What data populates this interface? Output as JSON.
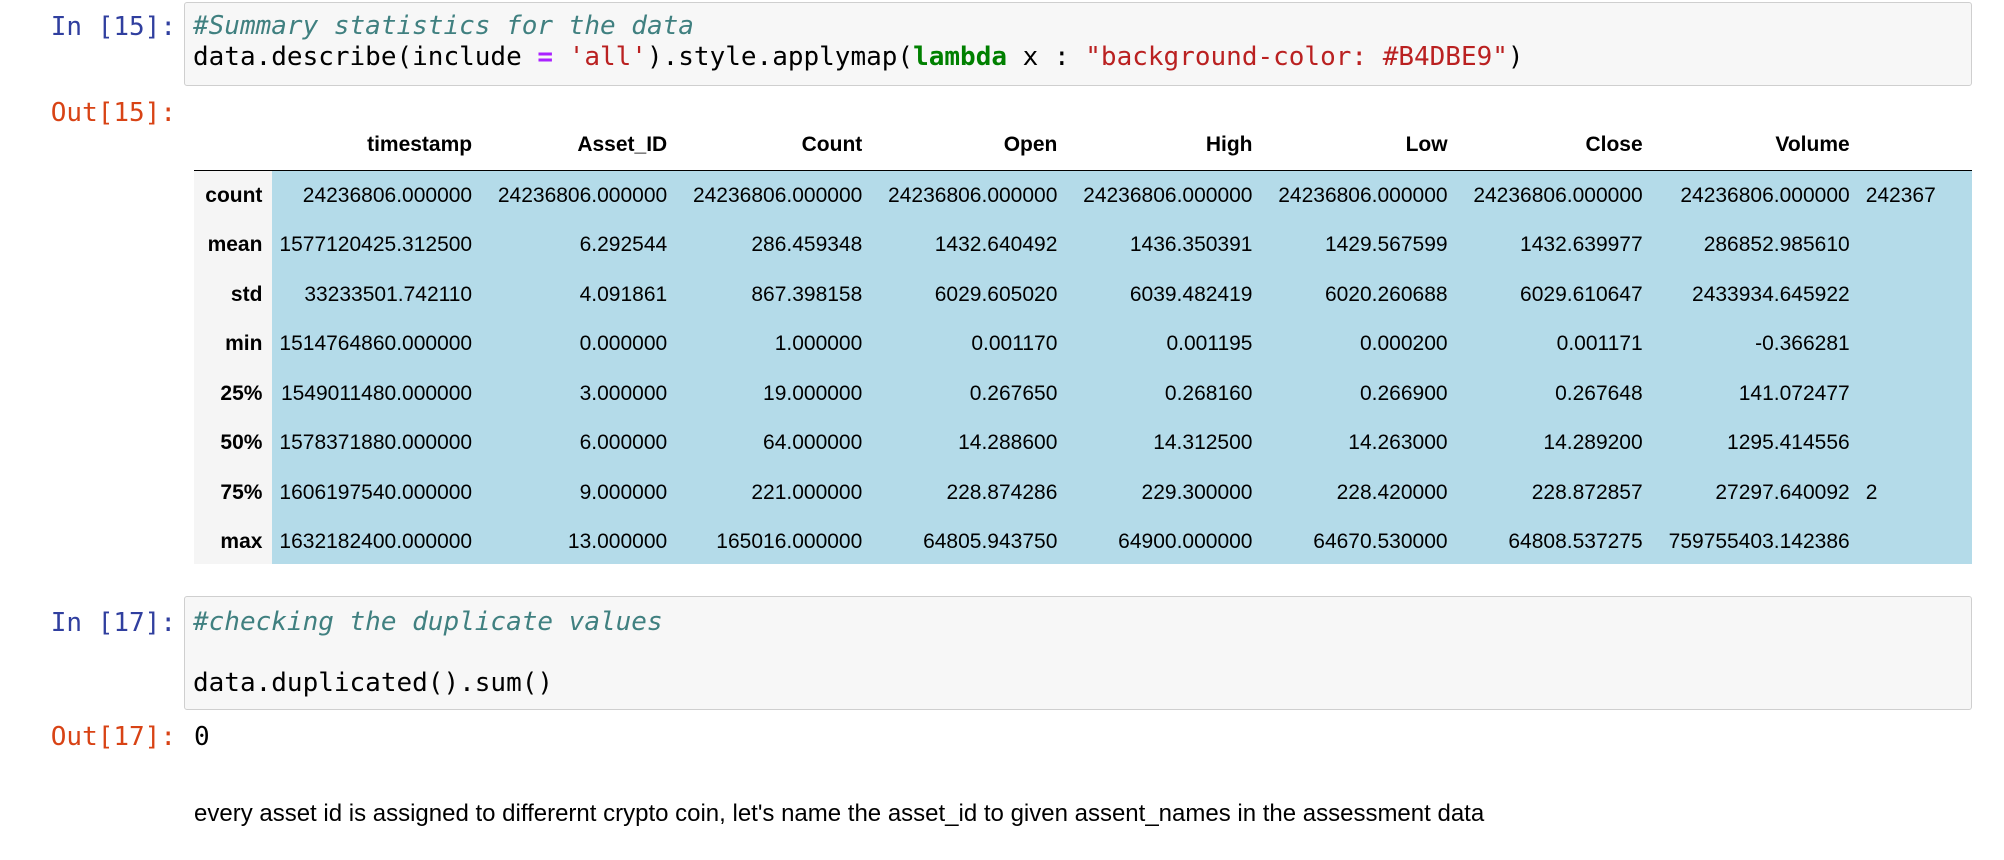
{
  "cells": {
    "in15": {
      "prompt": "In [15]:",
      "comment": "#Summary statistics for the data",
      "code_a": "data.describe(include ",
      "code_eq": "=",
      "code_b": " ",
      "code_str1": "'all'",
      "code_c": ").style.applymap(",
      "code_kw": "lambda",
      "code_d": " x : ",
      "code_str2": "\"background-color: #B4DBE9\"",
      "code_e": ")"
    },
    "out15": {
      "prompt": "Out[15]:"
    },
    "in17": {
      "prompt": "In [17]:",
      "comment": "#checking the duplicate values",
      "code": "data.duplicated().sum()"
    },
    "out17": {
      "prompt": "Out[17]:",
      "value": "0"
    },
    "markdown": {
      "text": "every asset id is assigned to differernt crypto coin, let's name the asset_id to given assent_names in the assessment data"
    }
  },
  "table": {
    "highlight_color": "#B4DBE9",
    "columns": [
      "timestamp",
      "Asset_ID",
      "Count",
      "Open",
      "High",
      "Low",
      "Close",
      "Volume",
      ""
    ],
    "rows": [
      {
        "index": "count",
        "values": [
          "24236806.000000",
          "24236806.000000",
          "24236806.000000",
          "24236806.000000",
          "24236806.000000",
          "24236806.000000",
          "24236806.000000",
          "24236806.000000",
          "242367"
        ]
      },
      {
        "index": "mean",
        "values": [
          "1577120425.312500",
          "6.292544",
          "286.459348",
          "1432.640492",
          "1436.350391",
          "1429.567599",
          "1432.639977",
          "286852.985610",
          ""
        ]
      },
      {
        "index": "std",
        "values": [
          "33233501.742110",
          "4.091861",
          "867.398158",
          "6029.605020",
          "6039.482419",
          "6020.260688",
          "6029.610647",
          "2433934.645922",
          ""
        ]
      },
      {
        "index": "min",
        "values": [
          "1514764860.000000",
          "0.000000",
          "1.000000",
          "0.001170",
          "0.001195",
          "0.000200",
          "0.001171",
          "-0.366281",
          ""
        ]
      },
      {
        "index": "25%",
        "values": [
          "1549011480.000000",
          "3.000000",
          "19.000000",
          "0.267650",
          "0.268160",
          "0.266900",
          "0.267648",
          "141.072477",
          ""
        ]
      },
      {
        "index": "50%",
        "values": [
          "1578371880.000000",
          "6.000000",
          "64.000000",
          "14.288600",
          "14.312500",
          "14.263000",
          "14.289200",
          "1295.414556",
          ""
        ]
      },
      {
        "index": "75%",
        "values": [
          "1606197540.000000",
          "9.000000",
          "221.000000",
          "228.874286",
          "229.300000",
          "228.420000",
          "228.872857",
          "27297.640092",
          "2"
        ]
      },
      {
        "index": "max",
        "values": [
          "1632182400.000000",
          "13.000000",
          "165016.000000",
          "64805.943750",
          "64900.000000",
          "64670.530000",
          "64808.537275",
          "759755403.142386",
          ""
        ]
      }
    ]
  }
}
